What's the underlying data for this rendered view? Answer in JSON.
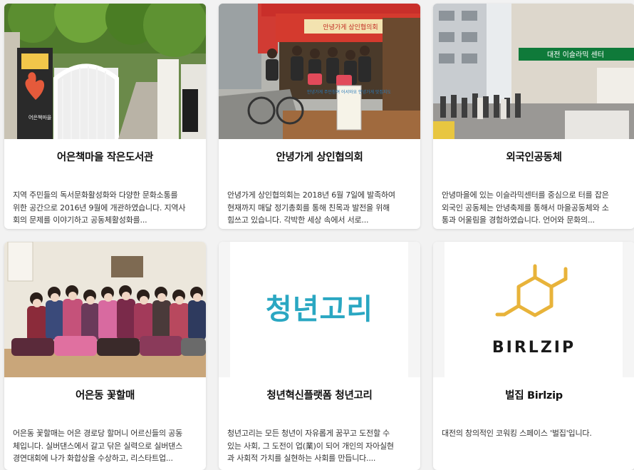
{
  "cards": [
    {
      "title": "어은책마을 작은도서관",
      "description": "  지역 주민들의 독서문화활성화와 다양한 문화소통를\n위한 공간으로 2016년 9월에 개관하였습니다. 지역사\n회의 문제를 이야기하고 공동체활성화를...",
      "image": "library-entrance-photo"
    },
    {
      "title": "안녕가게 상인협의회",
      "description": "안녕가게 상인협의회는 2018년 6월 7일에 발족하여\n현재까지 매달 정기총회를 통해 친목과 발전을 위해\n힘쓰고 있습니다. 각박한 세상 속에서 서로...",
      "image": "merchants-group-photo"
    },
    {
      "title": "외국인공동체",
      "description": "안녕마을에 있는 이슬라믹센터를 중심으로 터를 잡은\n외국인 공동체는 안녕축제를 통해서 마을공동체와 소\n통과 어울림을 경험하였습니다. 언어와 문화의...",
      "image": "street-crowd-photo"
    },
    {
      "title": "어은동 꽃할매",
      "description": "어은동 꽃할매는 어은 경로당 할머니 어르신들의 공동\n체입니다. 실버댄스에서 갈고 닦은 실력으로 실버댄스\n경연대회에 나가 화합상을 수상하고, 리스타트업...",
      "image": "grandmothers-group-photo"
    },
    {
      "title": "청년혁신플랫폼 청년고리",
      "description": "  청년고리는 모든 청년이 자유롭게 꿈꾸고 도전할 수\n있는 사회, 그 도전이 업(業)이 되어 개인의 자아실현\n과 사회적 가치를 실현하는 사회를 만듭니다....",
      "image": "logo",
      "logo_text": "청년고리"
    },
    {
      "title": "벌집 Birlzip",
      "description": "대전의 창의적인 코워킹 스페이스 '벌집'입니다.",
      "image": "logo",
      "logo_text": "BIRLZIP"
    }
  ],
  "photo_signs": {
    "library_sign": "어은책마을",
    "shop_banner": "안녕가게 상인협의회",
    "shop_board": "안녕가게\n주민참여\n어서와요\n안녕가게\n맛집지도",
    "center_sign": "대전 이슬라믹 센터"
  },
  "colors": {
    "background": "#f2f2f2",
    "card": "#ffffff",
    "title": "#111111",
    "text": "#333333",
    "cheongnyeon_logo": "#2aa7c2",
    "birlzip_hex": "#e8b33a"
  }
}
